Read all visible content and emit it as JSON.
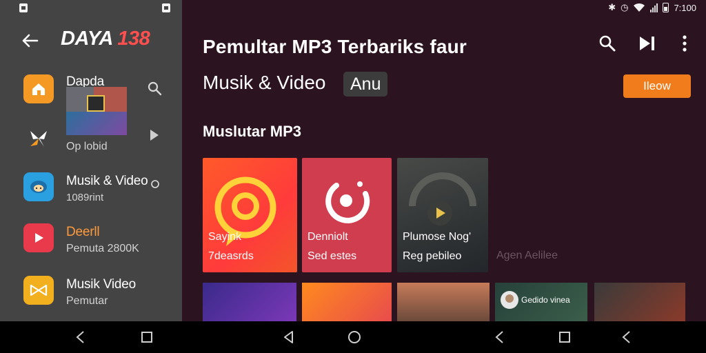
{
  "status_bar": {
    "time": "7:100"
  },
  "sidebar": {
    "brand_part1": "DAYA",
    "brand_part2": "138",
    "items": [
      {
        "title": "Dapda",
        "sub": "",
        "icon": "home-icon",
        "color": "#f49a24"
      },
      {
        "title": "",
        "sub": "Op lobid",
        "icon": "pinwheel-icon",
        "color": "#444444"
      },
      {
        "title": "Musik & Video",
        "sub": "1089rint",
        "icon": "pig-icon",
        "color": "#2aa0e0"
      },
      {
        "title": "Deerll",
        "sub": "Pemuta 2800K",
        "icon": "play-icon",
        "color": "#e83a4a"
      },
      {
        "title": "Musik Video",
        "sub": "Pemutar",
        "icon": "bowtie-icon",
        "color": "#f2b01e"
      }
    ]
  },
  "main": {
    "title": "Pemultar MP3 Terbariks faur",
    "subtitle": "Musik & Video",
    "chip": "Anu",
    "new_button": "Ileow",
    "section_title": "Muslutar MP3",
    "cards": [
      {
        "title": "Sayink",
        "sub": "7deasrds"
      },
      {
        "title": "Denniolt",
        "sub": "Sed estes"
      },
      {
        "title": "Plumose Nog'",
        "sub": "Reg pebileo"
      }
    ],
    "extra_text": "Agen Aelilee",
    "tile_label": "Gedido vinea"
  },
  "colors": {
    "sidebar_bg": "#444444",
    "main_bg": "#2c1320",
    "accent_orange": "#f07c1c",
    "brand_red": "#ff4f4f"
  }
}
